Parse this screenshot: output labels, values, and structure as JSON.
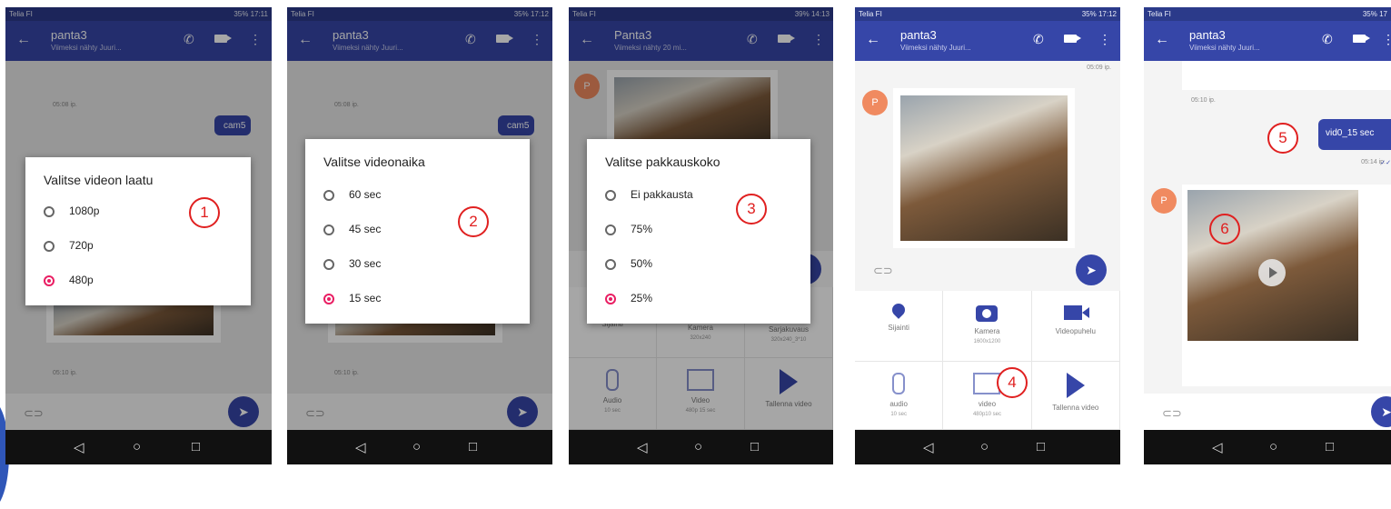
{
  "panels": [
    {
      "carrier": "Telia FI",
      "status": "35% 17:11",
      "contact": "panta3",
      "subtitle": "Viimeksi nähty Juuri...",
      "time1": "05:08 ip.",
      "bubble": "cam5",
      "time2": "05:10 ip.",
      "dialog_title": "Valitse videon laatu",
      "options": [
        "1080p",
        "720p",
        "480p"
      ],
      "selected": 2,
      "step": "1"
    },
    {
      "carrier": "Telia FI",
      "status": "35% 17:12",
      "contact": "panta3",
      "subtitle": "Viimeksi nähty Juuri...",
      "time1": "05:08 ip.",
      "bubble": "cam5",
      "time2": "05:10 ip.",
      "dialog_title": "Valitse videonaika",
      "options": [
        "60 sec",
        "45 sec",
        "30 sec",
        "15 sec"
      ],
      "selected": 3,
      "step": "2"
    },
    {
      "carrier": "Telia FI",
      "status": "39% 14:13",
      "contact": "Panta3",
      "subtitle": "Viimeksi nähty 20 mi...",
      "avatar": "P",
      "dialog_title": "Valitse pakkauskoko",
      "options": [
        "Ei pakkausta",
        "75%",
        "50%",
        "25%"
      ],
      "selected": 3,
      "step": "3",
      "grid": [
        {
          "label": "Sijainti",
          "sub": ""
        },
        {
          "label": "Kamera",
          "sub": "320x240"
        },
        {
          "label": "Sarjakuvaus",
          "sub": "320x240_3*10"
        },
        {
          "label": "Audio",
          "sub": "10 sec"
        },
        {
          "label": "Video",
          "sub": "480p 15 sec"
        },
        {
          "label": "Tallenna video",
          "sub": ""
        }
      ]
    },
    {
      "carrier": "Telia FI",
      "status": "35% 17:12",
      "contact": "panta3",
      "subtitle": "Viimeksi nähty Juuri...",
      "time_top": "05:09 ip.",
      "avatar": "P",
      "step": "4",
      "grid": [
        {
          "label": "Sijainti",
          "sub": ""
        },
        {
          "label": "Kamera",
          "sub": "1600x1200"
        },
        {
          "label": "Videopuhelu",
          "sub": ""
        },
        {
          "label": "audio",
          "sub": "10 sec"
        },
        {
          "label": "video",
          "sub": "480p10 sec"
        },
        {
          "label": "Tallenna video",
          "sub": ""
        }
      ]
    },
    {
      "carrier": "Telia FI",
      "status": "35% 17",
      "contact": "panta3",
      "subtitle": "Viimeksi nähty Juuri...",
      "time1": "05:10 ip.",
      "bubble": "vid0_15 sec",
      "time2": "05:14 ip.",
      "avatar": "P",
      "step_bubble": "5",
      "step_video": "6"
    }
  ],
  "icons": {
    "back": "←",
    "call": "✆",
    "more": "⋮",
    "attach": "⊂⊃",
    "send": "➤",
    "nav_back": "◁",
    "nav_home": "○",
    "nav_recent": "□"
  },
  "colors": {
    "appbar": "#3646a8",
    "accent": "#e91e63",
    "annotation": "#e02020"
  }
}
